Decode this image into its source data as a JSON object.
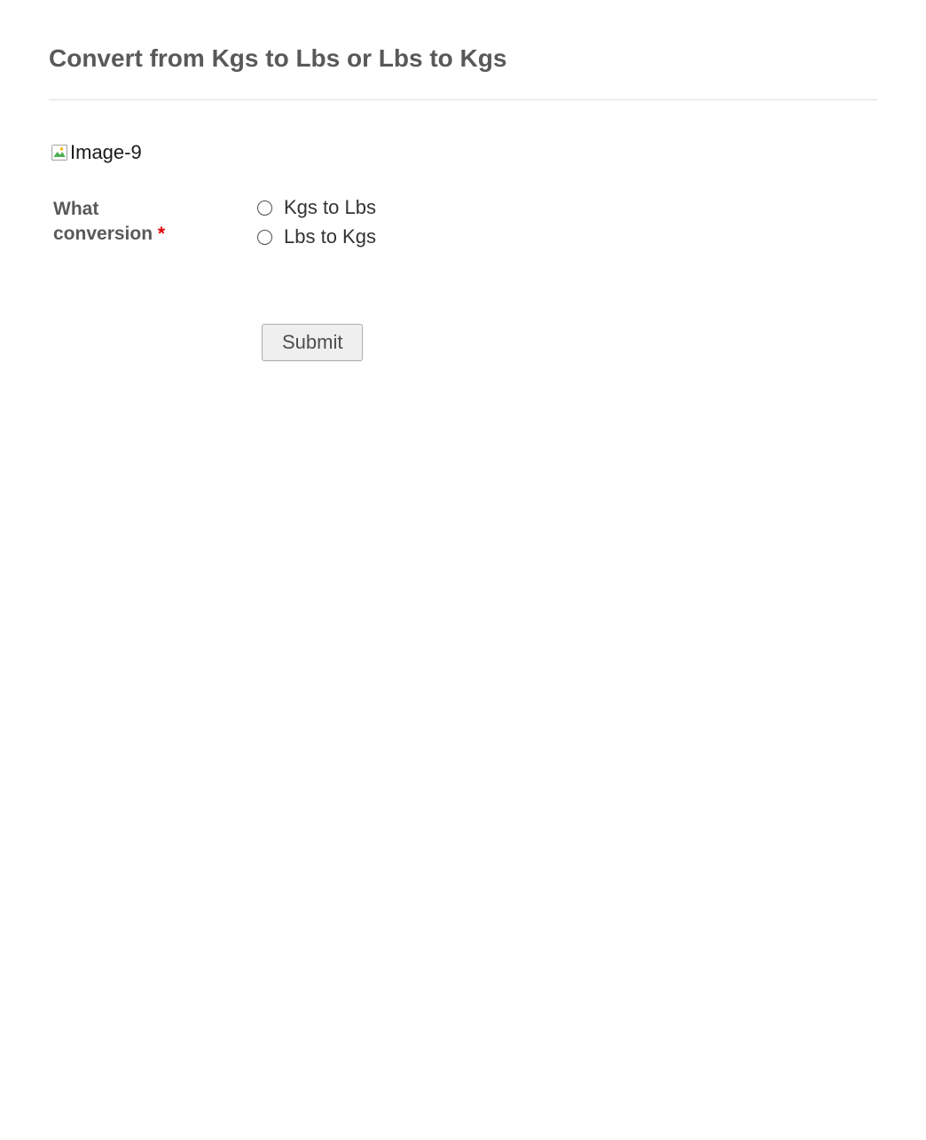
{
  "page": {
    "title": "Convert from Kgs to Lbs or Lbs to Kgs"
  },
  "brokenImage": {
    "altText": "Image-9"
  },
  "form": {
    "question": {
      "labelLine1": "What",
      "labelLine2": "conversion",
      "requiredMark": "*"
    },
    "options": [
      {
        "label": "Kgs to Lbs"
      },
      {
        "label": "Lbs to Kgs"
      }
    ],
    "submitLabel": "Submit"
  }
}
